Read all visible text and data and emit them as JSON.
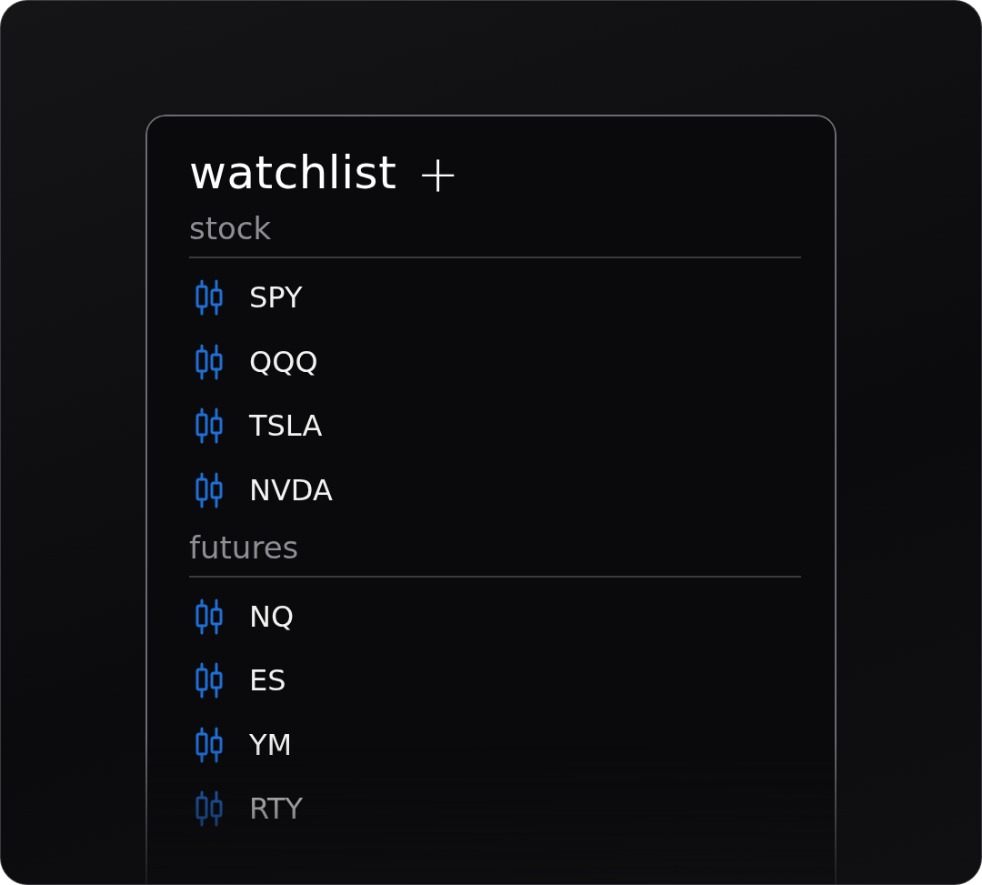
{
  "title": "watchlist",
  "add_button": "+",
  "groups": [
    {
      "label": "stock",
      "items": [
        {
          "symbol": "SPY"
        },
        {
          "symbol": "QQQ"
        },
        {
          "symbol": "TSLA"
        },
        {
          "symbol": "NVDA"
        }
      ]
    },
    {
      "label": "futures",
      "items": [
        {
          "symbol": "NQ"
        },
        {
          "symbol": "ES"
        },
        {
          "symbol": "YM"
        },
        {
          "symbol": "RTY"
        }
      ]
    }
  ]
}
